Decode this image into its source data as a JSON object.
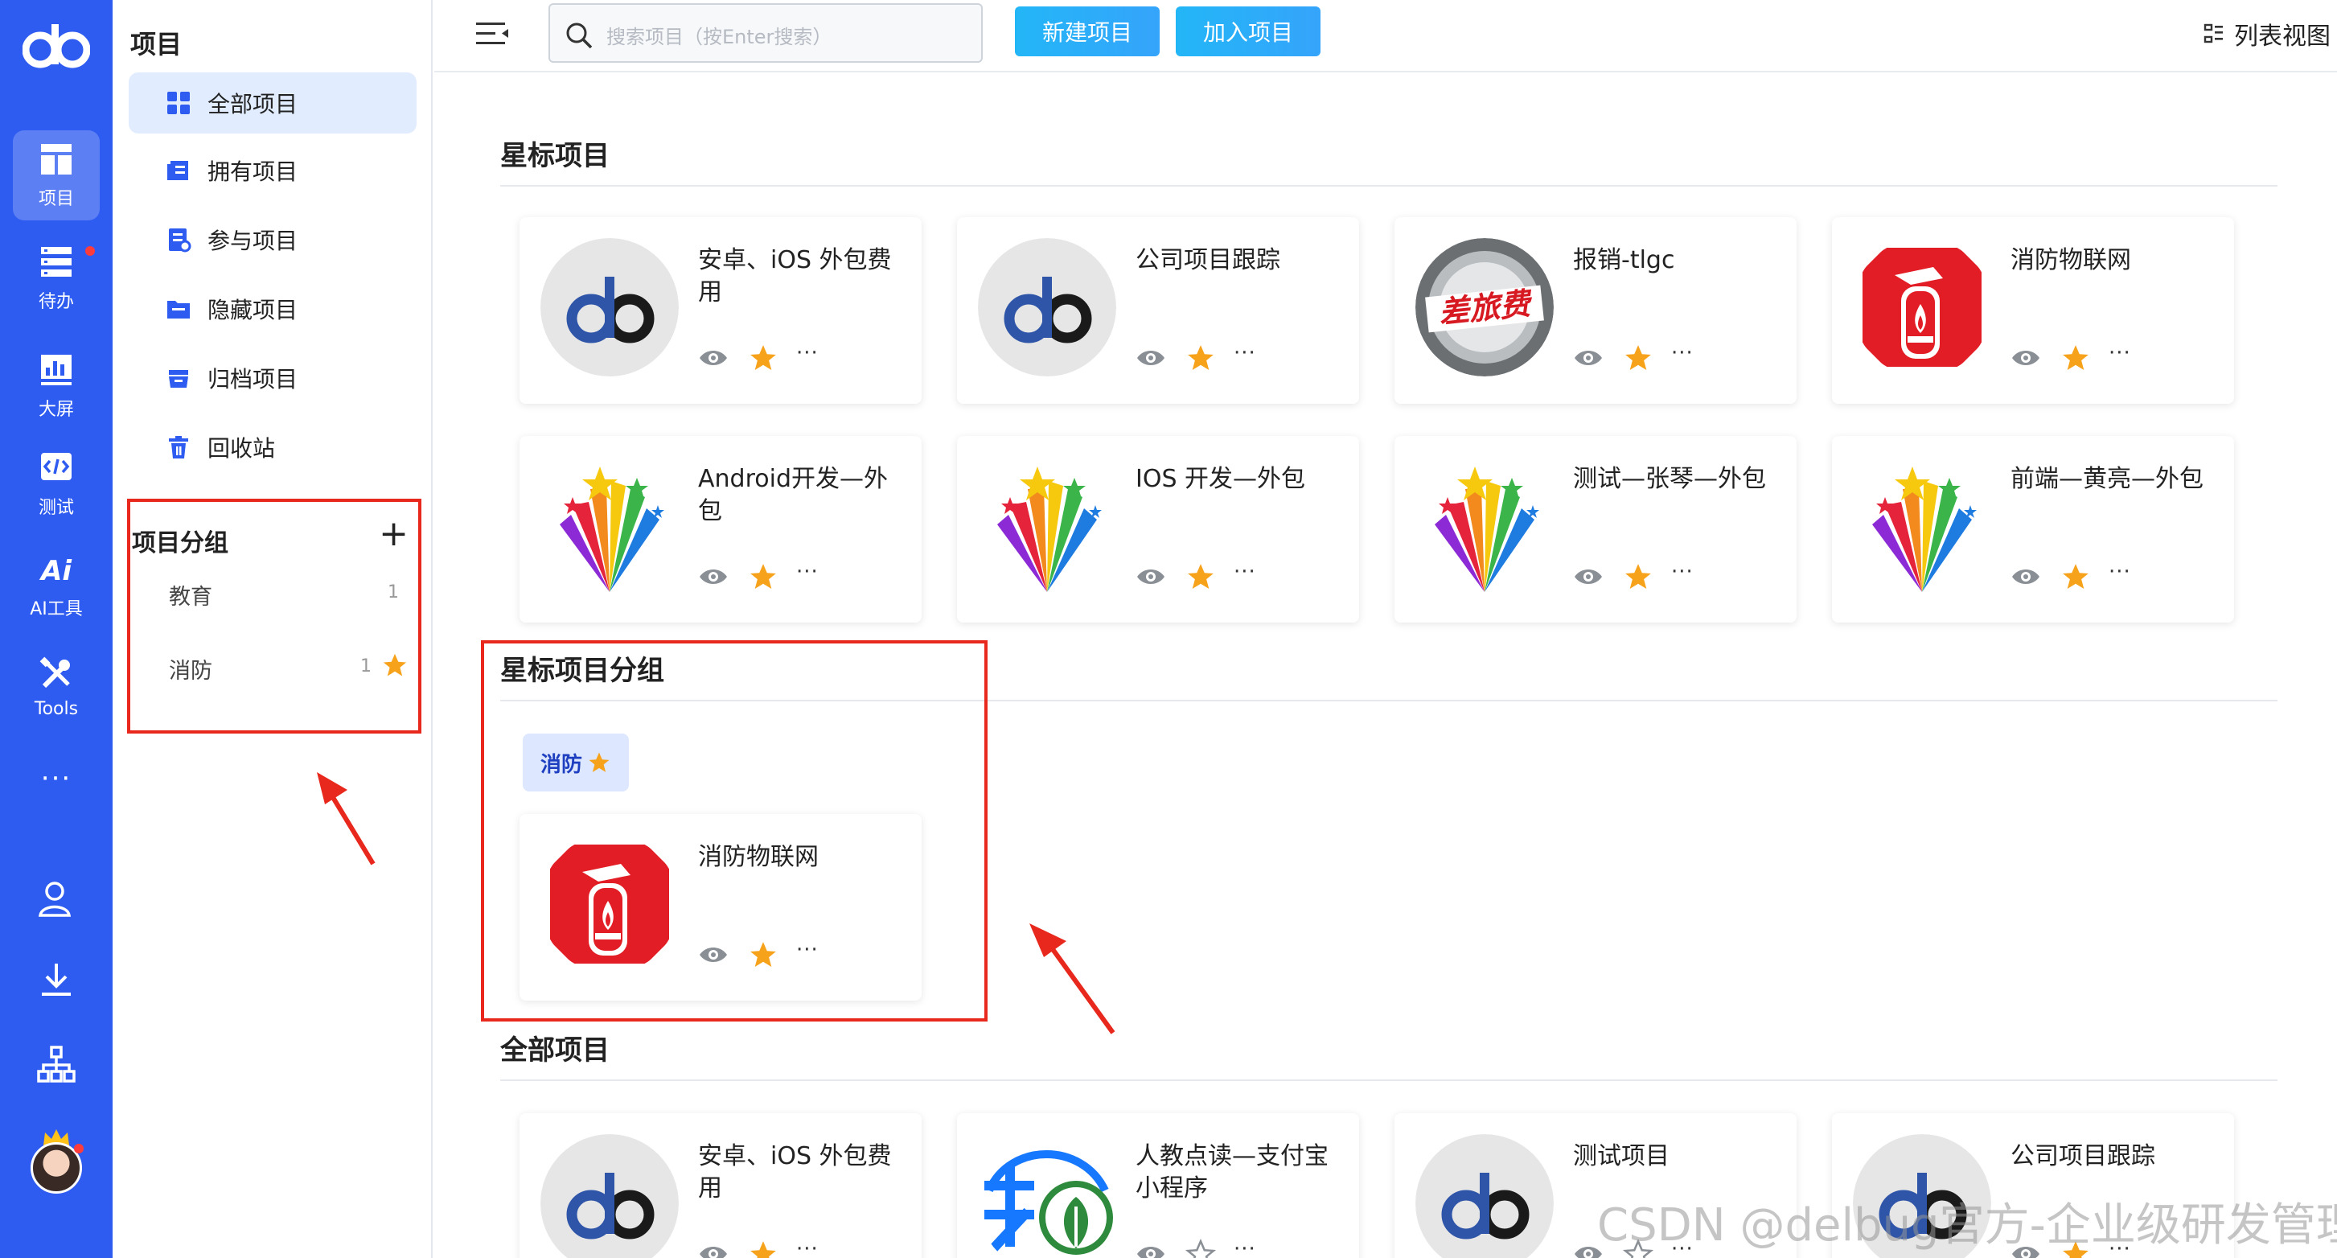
{
  "rail": {
    "items": [
      {
        "label": "项目"
      },
      {
        "label": "待办"
      },
      {
        "label": "大屏"
      },
      {
        "label": "测试"
      },
      {
        "label": "AI工具"
      },
      {
        "label": "Tools"
      }
    ],
    "more": "···"
  },
  "panel": {
    "title": "项目",
    "menu": [
      {
        "label": "全部项目"
      },
      {
        "label": "拥有项目"
      },
      {
        "label": "参与项目"
      },
      {
        "label": "隐藏项目"
      },
      {
        "label": "归档项目"
      },
      {
        "label": "回收站"
      }
    ],
    "groups_title": "项目分组",
    "add": "+",
    "groups": [
      {
        "name": "教育",
        "count": "1"
      },
      {
        "name": "消防",
        "count": "1"
      }
    ]
  },
  "topbar": {
    "search_placeholder": "搜索项目（按Enter搜索）",
    "new_project": "新建项目",
    "join_project": "加入项目",
    "list_view": "列表视图"
  },
  "sections": {
    "starred": "星标项目",
    "starred_groups": "星标项目分组",
    "all": "全部项目"
  },
  "starred_cards": [
    {
      "name": "安卓、iOS 外包费用",
      "logo": "db-logo"
    },
    {
      "name": "公司项目跟踪",
      "logo": "db-logo"
    },
    {
      "name": "报销-tlgc",
      "logo": "travel-expense-logo"
    },
    {
      "name": "消防物联网",
      "logo": "fire-extinguisher-logo"
    },
    {
      "name": "Android开发—外包",
      "logo": "stars-burst-logo"
    },
    {
      "name": "IOS 开发—外包",
      "logo": "stars-burst-logo"
    },
    {
      "name": "测试—张琴—外包",
      "logo": "stars-burst-logo"
    },
    {
      "name": "前端—黄亮—外包",
      "logo": "stars-burst-logo"
    }
  ],
  "starred_group_tag": "消防",
  "group_cards": [
    {
      "name": "消防物联网",
      "logo": "fire-extinguisher-logo"
    }
  ],
  "all_cards": [
    {
      "name": "安卓、iOS 外包费用",
      "logo": "db-logo",
      "starred": true
    },
    {
      "name": "人教点读—支付宝小程序",
      "logo": "alipay-logo",
      "starred": false
    },
    {
      "name": "测试项目",
      "logo": "db-logo",
      "starred": false
    },
    {
      "name": "公司项目跟踪",
      "logo": "db-logo",
      "starred": true
    }
  ],
  "logo_badge_text": "差旅费",
  "watermark": "CSDN @delbug官方-企业级研发管理",
  "colors": {
    "brand": "#2f5cf0",
    "accent": "#23b6f7",
    "star": "#f7a21b",
    "annotation": "#e8281c"
  }
}
